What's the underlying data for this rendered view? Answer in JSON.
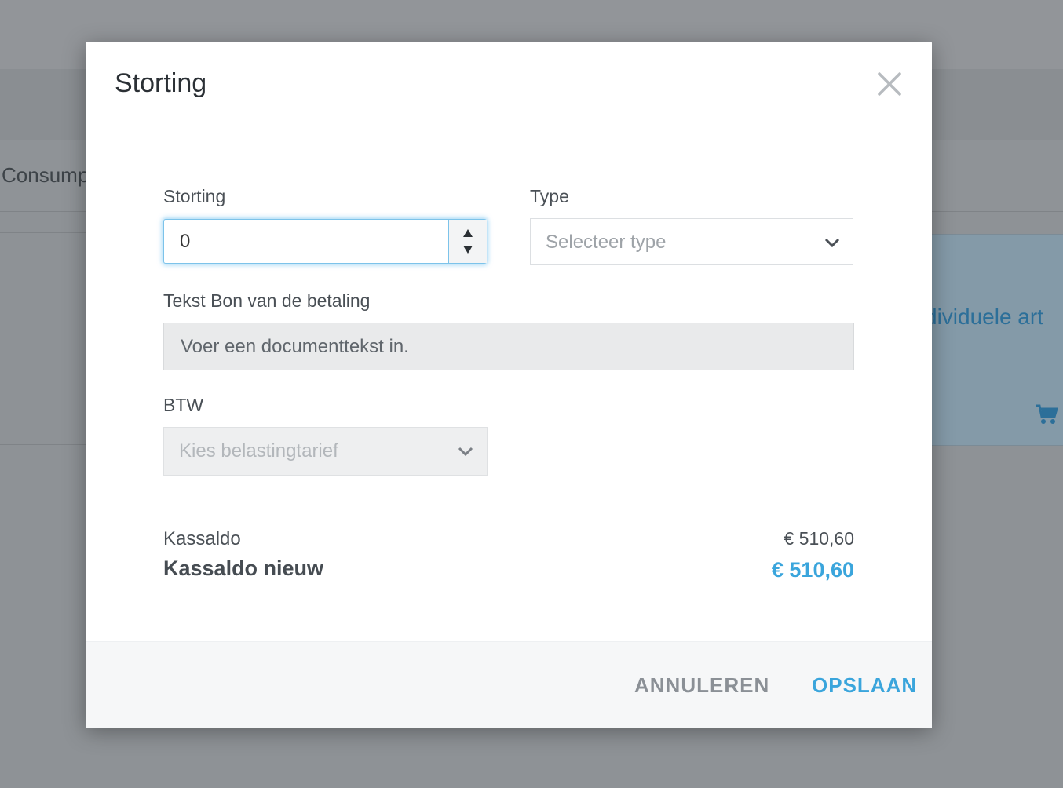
{
  "background": {
    "tab_text": "Consump",
    "card_text": "dividuele art"
  },
  "modal": {
    "title": "Storting",
    "storting": {
      "label": "Storting",
      "value": "0"
    },
    "type": {
      "label": "Type",
      "placeholder": "Selecteer type"
    },
    "document_text": {
      "label": "Tekst Bon van de betaling",
      "placeholder": "Voer een documenttekst in."
    },
    "btw": {
      "label": "BTW",
      "placeholder": "Kies belastingtarief"
    },
    "summary": {
      "balance_label": "Kassaldo",
      "balance_value": "€ 510,60",
      "new_balance_label": "Kassaldo nieuw",
      "new_balance_value": "€ 510,60"
    },
    "footer": {
      "cancel_label": "ANNULEREN",
      "save_label": "OPSLAAN"
    }
  },
  "colors": {
    "accent": "#3aa5dc",
    "overlay": "#8e9296"
  }
}
